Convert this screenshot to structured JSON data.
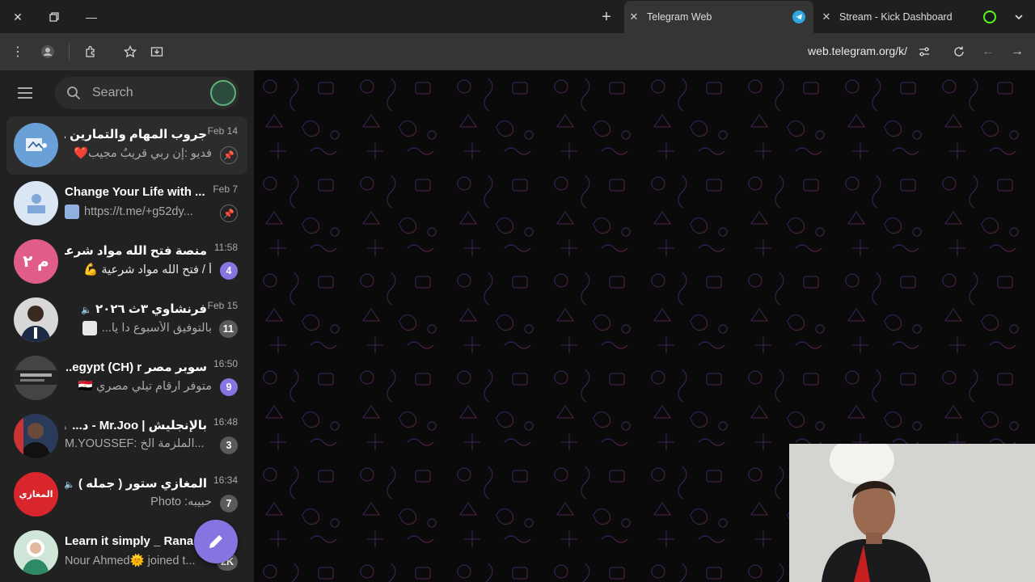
{
  "browser": {
    "tabs": [
      {
        "title": "Telegram Web",
        "active": true,
        "favicon": "telegram-icon"
      },
      {
        "title": "Stream - Kick Dashboard",
        "active": false,
        "favicon": "kick-icon"
      }
    ],
    "url": "web.telegram.org/k/"
  },
  "sidebar": {
    "search_placeholder": "Search",
    "chats": [
      {
        "title": "جروب المهام والتمارين ...",
        "time": "Feb 14",
        "preview": "فديو :إن ربي قريبٌ مجيب❤️",
        "pinned": true,
        "avatar_color": "#6aa0d8",
        "rtl": true
      },
      {
        "title": "Change Your Life with ...",
        "time": "Feb 7",
        "preview": "https://t.me/+g52dy...",
        "pinned": true,
        "avatar_color": "#7fa8d8",
        "rtl": false
      },
      {
        "title": "منصة فتح الله مواد شرعية...",
        "time": "11:58",
        "preview": "أ / فتح الله مواد شرعية 💪",
        "badge": "4",
        "badge_style": "purple",
        "avatar_text": "م ٢",
        "avatar_color": "#e05c8a",
        "rtl": true
      },
      {
        "title": "فرنشاوي ٣ث ٢٠٢٦",
        "time": "Feb 15",
        "preview": "بالتوفيق الأسبوع دا يا...",
        "badge": "11",
        "badge_style": "muted",
        "muted": true,
        "avatar_color": "#d8d8d8",
        "rtl": true
      },
      {
        "title": "سوبر مصر egypt (CH) r...",
        "time": "16:50",
        "preview": "متوفر ارقام تيلي مصري 🇪🇬",
        "badge": "9",
        "badge_style": "purple",
        "avatar_color": "#444444",
        "rtl": true
      },
      {
        "title": "بالإنجليش | Mr.Joo - د...",
        "time": "16:48",
        "preview": "M.YOUSSEF: الملزمة الخ...",
        "badge": "3",
        "badge_style": "muted",
        "muted": true,
        "avatar_color": "#2a3a5a",
        "rtl": true
      },
      {
        "title": "المغازي ستور ( جمله )",
        "time": "16:34",
        "preview": "حبيبه: Photo",
        "badge": "7",
        "badge_style": "muted",
        "muted": true,
        "avatar_text": "المغازي",
        "avatar_color": "#d8262c",
        "rtl": true
      },
      {
        "title": "Learn it simply _ Rana",
        "time": "",
        "preview": "Nour Ahmed🌞 joined t...",
        "badge": "2K",
        "badge_style": "muted",
        "avatar_color": "#cfe6d8",
        "rtl": false
      }
    ]
  },
  "colors": {
    "accent": "#8774e1",
    "sidebar_bg": "#212121",
    "main_bg": "#0a0a0a"
  }
}
